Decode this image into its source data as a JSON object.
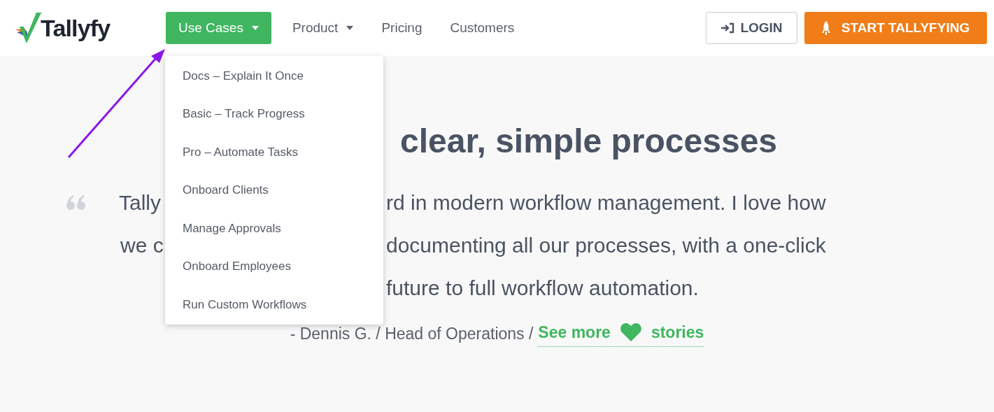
{
  "header": {
    "logo_text": "Tallyfy",
    "nav": [
      {
        "label": "Use Cases",
        "kind": "dropdown",
        "selected": true
      },
      {
        "label": "Product",
        "kind": "dropdown",
        "selected": false
      },
      {
        "label": "Pricing",
        "kind": "link",
        "selected": false
      },
      {
        "label": "Customers",
        "kind": "link",
        "selected": false
      }
    ],
    "login": "LOGIN",
    "cta": "START TALLYFYING"
  },
  "dropdown_menu": [
    "Docs – Explain It Once",
    "Basic – Track Progress",
    "Pro – Automate Tasks",
    "Onboard Clients",
    "Manage Approvals",
    "Onboard Employees",
    "Run Custom Workflows"
  ],
  "hero": {
    "heading": "clear, simple processes",
    "quote_lines": [
      {
        "left": "Tally",
        "right": "rd in modern workflow management. I love how"
      },
      {
        "left": "we c",
        "right": "documenting all our processes, with a one-click"
      },
      {
        "right": "future to full workflow automation."
      }
    ],
    "attribution": "- Dennis G. / Head of Operations /",
    "link_start": "See more",
    "link_end": "stories"
  }
}
